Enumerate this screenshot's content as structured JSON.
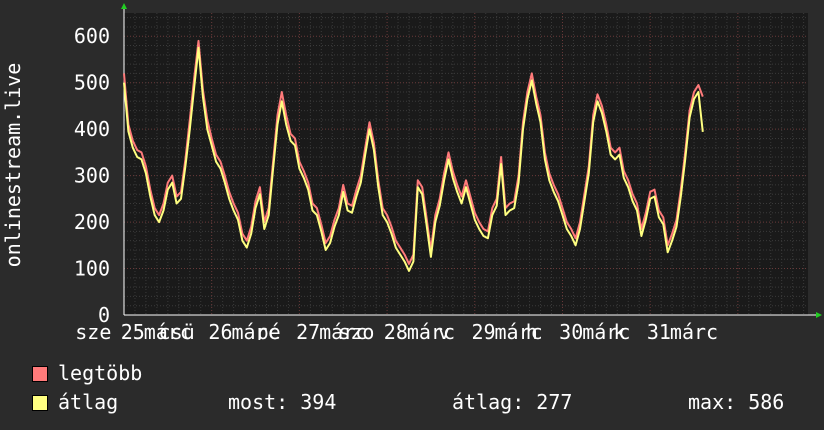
{
  "chart_data": {
    "type": "line",
    "ylabel": "onlinestream.live",
    "ylim": [
      0,
      650
    ],
    "yticks": [
      0,
      100,
      200,
      300,
      400,
      500,
      600
    ],
    "xlim": [
      0,
      7.8
    ],
    "xtick_labels": [
      {
        "x": -0.35,
        "label": "sze"
      },
      {
        "x": 0.1,
        "label": "25"
      },
      {
        "x": 0.5,
        "label": "márc"
      },
      {
        "x": 0.6,
        "label": "csü"
      },
      {
        "x": 1.1,
        "label": "26"
      },
      {
        "x": 1.5,
        "label": "márc"
      },
      {
        "x": 1.65,
        "label": "pé"
      },
      {
        "x": 2.1,
        "label": "27"
      },
      {
        "x": 2.5,
        "label": "márc"
      },
      {
        "x": 2.65,
        "label": "szo"
      },
      {
        "x": 3.1,
        "label": "28"
      },
      {
        "x": 3.5,
        "label": "márc"
      },
      {
        "x": 3.65,
        "label": "v"
      },
      {
        "x": 4.1,
        "label": "29"
      },
      {
        "x": 4.5,
        "label": "márc"
      },
      {
        "x": 4.65,
        "label": "h"
      },
      {
        "x": 5.1,
        "label": "30"
      },
      {
        "x": 5.5,
        "label": "márc"
      },
      {
        "x": 5.65,
        "label": "k"
      },
      {
        "x": 6.1,
        "label": "31"
      },
      {
        "x": 6.5,
        "label": "márc"
      }
    ],
    "grid": true,
    "series": [
      {
        "name": "legtöbb",
        "color": "#ff7a7a"
      },
      {
        "name": "átlag",
        "color": "#ffff80"
      }
    ],
    "x": [
      0,
      0.05,
      0.1,
      0.15,
      0.2,
      0.25,
      0.3,
      0.35,
      0.4,
      0.45,
      0.5,
      0.55,
      0.6,
      0.65,
      0.7,
      0.75,
      0.8,
      0.85,
      0.9,
      0.95,
      1,
      1.05,
      1.1,
      1.15,
      1.2,
      1.25,
      1.3,
      1.35,
      1.4,
      1.45,
      1.5,
      1.55,
      1.6,
      1.65,
      1.7,
      1.75,
      1.8,
      1.85,
      1.9,
      1.95,
      2,
      2.05,
      2.1,
      2.15,
      2.2,
      2.25,
      2.3,
      2.35,
      2.4,
      2.45,
      2.5,
      2.55,
      2.6,
      2.65,
      2.7,
      2.75,
      2.8,
      2.85,
      2.9,
      2.95,
      3,
      3.05,
      3.1,
      3.15,
      3.2,
      3.25,
      3.3,
      3.35,
      3.4,
      3.45,
      3.5,
      3.55,
      3.6,
      3.65,
      3.7,
      3.75,
      3.8,
      3.85,
      3.9,
      3.95,
      4,
      4.05,
      4.1,
      4.15,
      4.2,
      4.25,
      4.3,
      4.35,
      4.4,
      4.45,
      4.5,
      4.55,
      4.6,
      4.65,
      4.7,
      4.75,
      4.8,
      4.85,
      4.9,
      4.95,
      5,
      5.05,
      5.1,
      5.15,
      5.2,
      5.25,
      5.3,
      5.35,
      5.4,
      5.45,
      5.5,
      5.55,
      5.6,
      5.65,
      5.7,
      5.75,
      5.8,
      5.85,
      5.9,
      5.95,
      6,
      6.05,
      6.1,
      6.15,
      6.2,
      6.25,
      6.3,
      6.35,
      6.4,
      6.45,
      6.5,
      6.55,
      6.6,
      6.65,
      6.7,
      6.75,
      6.8,
      6.85,
      6.9,
      6.95,
      7,
      7.05,
      7.1,
      7.15,
      7.2,
      7.25,
      7.3,
      7.35,
      7.4,
      7.45,
      7.5,
      7.55,
      7.6,
      7.65,
      7.7,
      7.75
    ],
    "max_values": [
      520,
      410,
      375,
      355,
      350,
      320,
      270,
      230,
      215,
      240,
      285,
      300,
      255,
      265,
      335,
      420,
      510,
      590,
      485,
      420,
      380,
      345,
      330,
      300,
      265,
      240,
      220,
      175,
      160,
      190,
      245,
      275,
      200,
      230,
      330,
      430,
      480,
      430,
      390,
      380,
      330,
      310,
      285,
      240,
      230,
      195,
      155,
      170,
      205,
      230,
      280,
      240,
      235,
      270,
      300,
      360,
      415,
      370,
      290,
      230,
      215,
      190,
      160,
      145,
      130,
      110,
      130,
      290,
      275,
      210,
      140,
      215,
      250,
      305,
      350,
      310,
      280,
      255,
      290,
      255,
      220,
      200,
      185,
      180,
      230,
      250,
      340,
      230,
      240,
      245,
      300,
      415,
      480,
      520,
      470,
      430,
      350,
      305,
      280,
      260,
      230,
      200,
      185,
      165,
      200,
      260,
      320,
      430,
      475,
      450,
      410,
      360,
      350,
      360,
      310,
      290,
      260,
      240,
      185,
      220,
      265,
      270,
      225,
      210,
      150,
      175,
      205,
      270,
      350,
      440,
      480,
      495,
      470
    ],
    "avg_values": [
      500,
      395,
      360,
      340,
      335,
      305,
      255,
      215,
      200,
      225,
      270,
      285,
      240,
      250,
      320,
      400,
      490,
      575,
      470,
      400,
      365,
      330,
      315,
      285,
      250,
      225,
      205,
      160,
      145,
      175,
      230,
      260,
      185,
      215,
      315,
      410,
      460,
      410,
      375,
      365,
      315,
      295,
      270,
      225,
      215,
      180,
      140,
      155,
      190,
      215,
      265,
      225,
      220,
      255,
      285,
      345,
      400,
      355,
      275,
      215,
      200,
      175,
      145,
      130,
      115,
      95,
      115,
      275,
      260,
      195,
      125,
      200,
      235,
      290,
      335,
      295,
      265,
      240,
      275,
      240,
      205,
      185,
      170,
      165,
      215,
      235,
      325,
      215,
      225,
      230,
      285,
      400,
      465,
      505,
      455,
      415,
      335,
      290,
      265,
      245,
      215,
      185,
      170,
      150,
      185,
      245,
      305,
      415,
      460,
      435,
      395,
      345,
      335,
      345,
      295,
      275,
      245,
      225,
      170,
      205,
      250,
      255,
      210,
      195,
      135,
      160,
      190,
      255,
      335,
      425,
      465,
      480,
      394
    ]
  },
  "legend": {
    "max_label": "legtöbb",
    "avg_label": "átlag",
    "max_color": "#ff7a7a",
    "avg_color": "#ffff80"
  },
  "stats": {
    "now": "most: 394",
    "avg": "átlag: 277",
    "max": "max: 586"
  }
}
